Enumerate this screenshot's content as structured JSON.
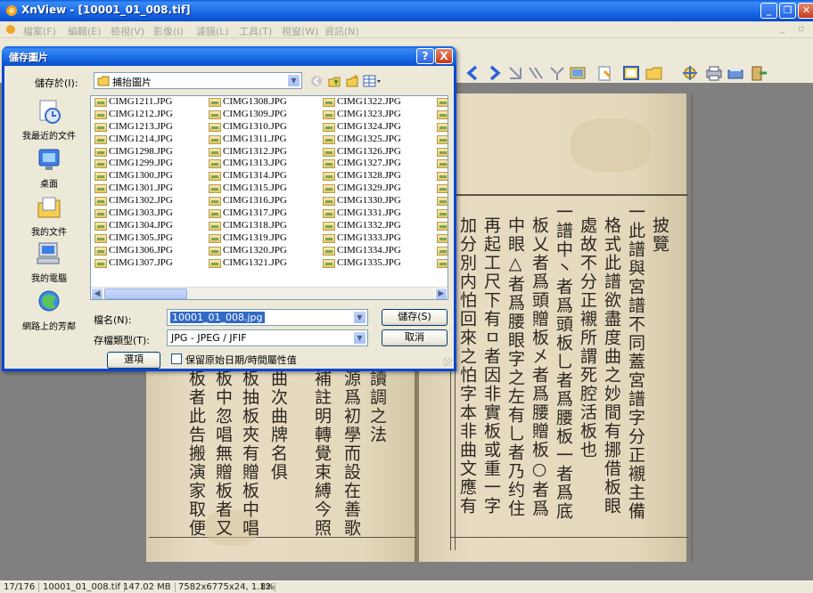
{
  "window": {
    "title": "XnView - [10001_01_008.tif]",
    "menu": [
      "檔案(F)",
      "編輯(E)",
      "檢視(V)",
      "影像(I)",
      "濾鏡(L)",
      "工具(T)",
      "視窗(W)",
      "資訊(N)"
    ],
    "mdi_controls": "_ ▫"
  },
  "dialog": {
    "title": "儲存圖片",
    "help_label": "?",
    "close_label": "X",
    "save_in_label": "儲存於(I):",
    "save_in_value": "捕抬圖片",
    "places": [
      "我最近的文件",
      "桌面",
      "我的文件",
      "我的電腦",
      "網路上的芳鄰"
    ],
    "files": [
      [
        "CIMG1211.JPG",
        "CIMG1212.JPG",
        "CIMG1213.JPG",
        "CIMG1214.JPG",
        "CIMG1298.JPG",
        "CIMG1299.JPG",
        "CIMG1300.JPG",
        "CIMG1301.JPG",
        "CIMG1302.JPG",
        "CIMG1303.JPG",
        "CIMG1304.JPG",
        "CIMG1305.JPG",
        "CIMG1306.JPG",
        "CIMG1307.JPG"
      ],
      [
        "CIMG1308.JPG",
        "CIMG1309.JPG",
        "CIMG1310.JPG",
        "CIMG1311.JPG",
        "CIMG1312.JPG",
        "CIMG1313.JPG",
        "CIMG1314.JPG",
        "CIMG1315.JPG",
        "CIMG1316.JPG",
        "CIMG1317.JPG",
        "CIMG1318.JPG",
        "CIMG1319.JPG",
        "CIMG1320.JPG",
        "CIMG1321.JPG"
      ],
      [
        "CIMG1322.JPG",
        "CIMG1323.JPG",
        "CIMG1324.JPG",
        "CIMG1325.JPG",
        "CIMG1326.JPG",
        "CIMG1327.JPG",
        "CIMG1328.JPG",
        "CIMG1329.JPG",
        "CIMG1330.JPG",
        "CIMG1331.JPG",
        "CIMG1332.JPG",
        "CIMG1333.JPG",
        "CIMG1334.JPG",
        "CIMG1335.JPG"
      ]
    ],
    "filename_label": "檔名(N):",
    "filename_value": "10001_01_008.jpg",
    "filetype_label": "存檔類型(T):",
    "filetype_value": "JPG - JPEG / JFIF",
    "save_button": "儲存(S)",
    "cancel_button": "取消",
    "options_button": "選項",
    "keep_date_label": "保留原始日期/時間屬性值"
  },
  "page_text": {
    "right_columns": [
      "一此譜與宮譜不同蓋宮譜字分正襯主備",
      "格式此譜欲盡度曲之妙間有挪借板眼",
      "處故不分正襯所謂死腔活板也",
      "一譜中丶者爲頭板乚者爲腰板一者爲底",
      "板乂者爲頭贈板㐅者爲腰贈板○者爲",
      "中眼△者爲腰眼字之左有乚者乃约住",
      "再起工尺下有ㅁ者因非實板或重一字",
      "加分別内怕回來之怕字本非曲文應有"
    ],
    "right_marginal": "披覽",
    "left_columns": [
      "讀調之法",
      "源爲初學而設在善歌",
      "補註明轉覺束縛今照",
      "曲次曲牌名俱",
      "板抽板夾有贈板中唱",
      "板中忽唱無贈板者又",
      "板者此告搬演家取便"
    ]
  },
  "status": [
    "17/176",
    "10001_01_008.tif",
    "147.02 MB",
    "7582x6775x24, 1.12",
    "8%"
  ]
}
